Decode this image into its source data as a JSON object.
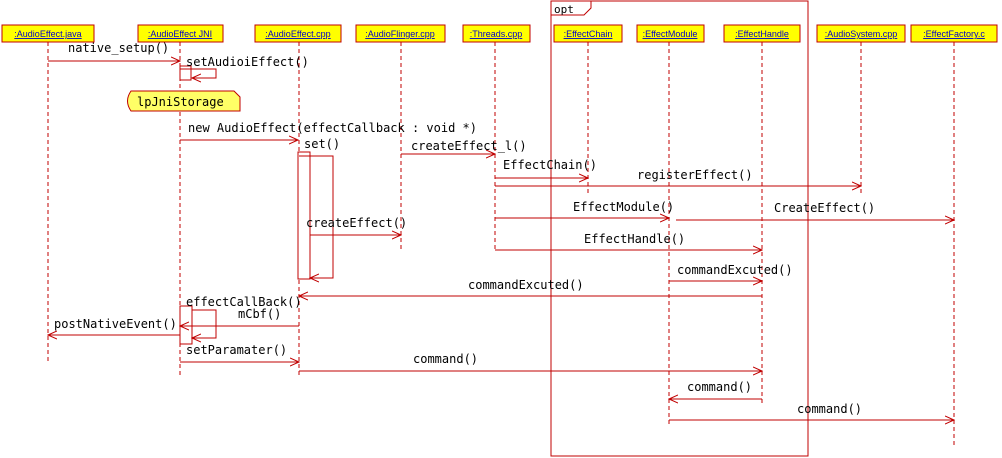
{
  "participants": [
    ":AudioEffect.java",
    ":AudioEffect JNI",
    ":AudioEffect.cpp",
    ":AudioFlinger.cpp",
    ":Threads.cpp",
    ":EffectChain",
    ":EffectModule",
    ":EffectHandle",
    ":AudioSystem.cpp",
    ":EffectFactory.c"
  ],
  "frame": {
    "label": "opt"
  },
  "note": "lpJniStorage",
  "messages": [
    "native_setup()",
    "setAudioiEffect()",
    "new AudioEffect(effectCallback : void *)",
    "set()",
    "createEffect_l()",
    "EffectChain()",
    "registerEffect()",
    "EffectModule()",
    "CreateEffect()",
    "createEffect()",
    "EffectHandle()",
    "commandExcuted()",
    "commandExcuted()",
    "effectCallBack()",
    "mCbf()",
    "postNativeEvent()",
    "setParamater()",
    "command()",
    "command()",
    "command()"
  ],
  "colors": {
    "line": "#c00000",
    "header_fill": "#ffff00",
    "header_text": "#0000cc",
    "note_fill": "#ffff66"
  }
}
